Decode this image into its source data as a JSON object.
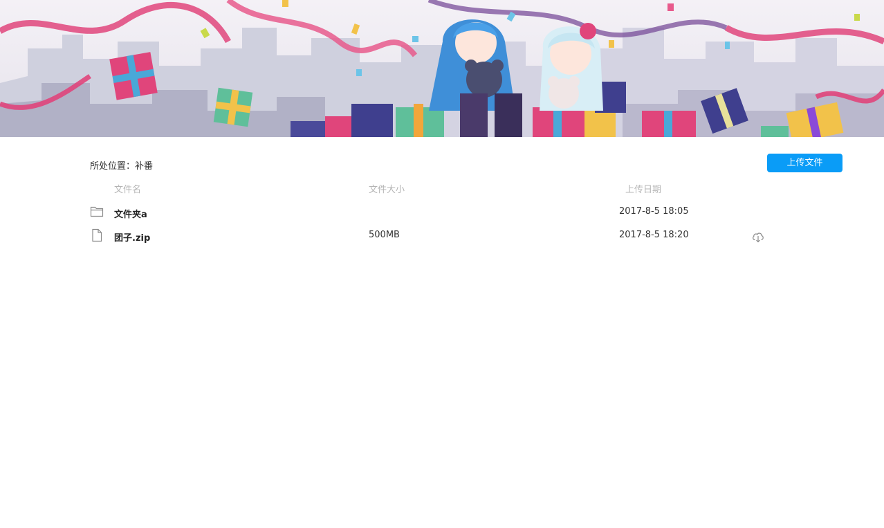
{
  "breadcrumb": {
    "label": "所处位置：补番"
  },
  "toolbar": {
    "upload_label": "上传文件"
  },
  "columns": {
    "name": "文件名",
    "size": "文件大小",
    "date": "上传日期"
  },
  "files": [
    {
      "name": "文件夹a",
      "size": "",
      "date": "2017-8-5 18:05",
      "icon": "folder-icon",
      "downloadable": false
    },
    {
      "name": "团子.zip",
      "size": "500MB",
      "date": "2017-8-5 18:20",
      "icon": "file-icon",
      "downloadable": true
    }
  ],
  "colors": {
    "accent": "#0a9cf7",
    "header_text": "#b4b4b4",
    "body_text": "#333333"
  }
}
